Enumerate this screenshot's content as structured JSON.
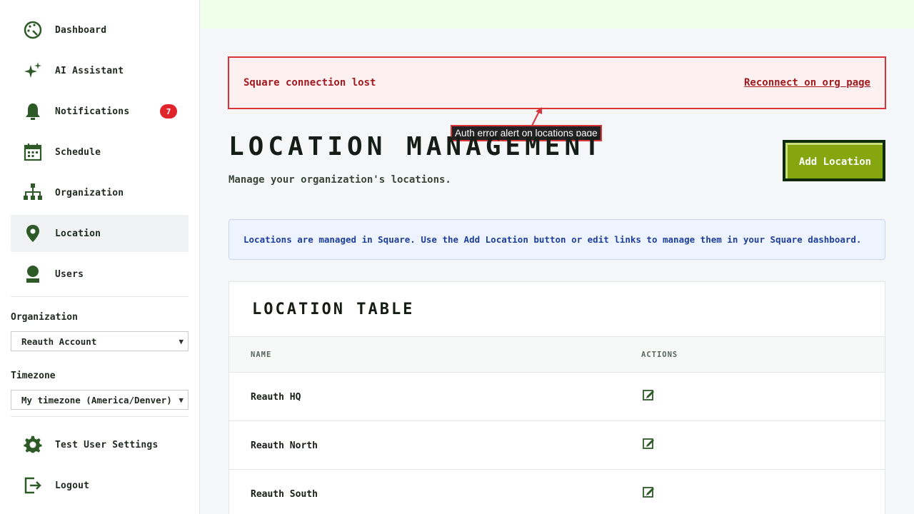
{
  "sidebar": {
    "nav": [
      {
        "label": "Dashboard",
        "icon": "dashboard-icon"
      },
      {
        "label": "AI Assistant",
        "icon": "sparkle-icon"
      },
      {
        "label": "Notifications",
        "icon": "bell-icon",
        "badge": "7"
      },
      {
        "label": "Schedule",
        "icon": "calendar-icon"
      },
      {
        "label": "Organization",
        "icon": "org-chart-icon"
      },
      {
        "label": "Location",
        "icon": "map-pin-icon",
        "active": true
      },
      {
        "label": "Users",
        "icon": "user-icon"
      }
    ],
    "organization_label": "Organization",
    "organization_value": "Reauth Account",
    "timezone_label": "Timezone",
    "timezone_value": "My timezone (America/Denver)",
    "bottom": [
      {
        "label": "Test User Settings",
        "icon": "gear-icon"
      },
      {
        "label": "Logout",
        "icon": "logout-icon"
      }
    ]
  },
  "alert": {
    "message": "Square connection lost",
    "link": "Reconnect on org page"
  },
  "annotation": {
    "label": "Auth error alert on locations page"
  },
  "header": {
    "title": "Location Management",
    "subtitle": "Manage your organization's locations.",
    "add_button": "Add Location"
  },
  "info": {
    "message": "Locations are managed in Square. Use the Add Location button or edit links to manage them in your Square dashboard."
  },
  "table": {
    "title": "Location Table",
    "columns": [
      "NAME",
      "ACTIONS"
    ],
    "rows": [
      {
        "name": "Reauth HQ"
      },
      {
        "name": "Reauth North"
      },
      {
        "name": "Reauth South"
      }
    ]
  },
  "colors": {
    "accent_green": "#85a60f",
    "dark_green": "#2d5a27",
    "alert_red": "#d8343a",
    "badge_red": "#e0242c"
  }
}
